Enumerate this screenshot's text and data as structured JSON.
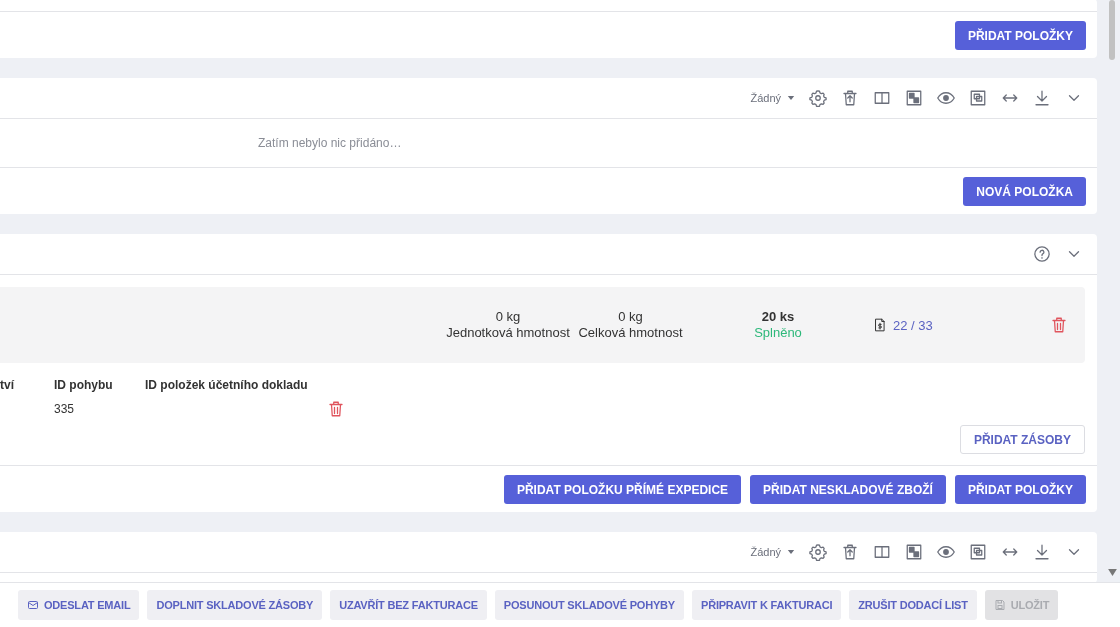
{
  "top_panel": {
    "buttons": [
      {
        "label": "PŘIDAT POLOŽKY",
        "kind": "primary"
      }
    ]
  },
  "list_panel": {
    "toolbar": {
      "filter": "Žádný"
    },
    "empty_text": "Zatím nebylo nic přidáno…",
    "buttons": [
      {
        "label": "NOVÁ POLOŽKA",
        "kind": "primary"
      }
    ]
  },
  "item_panel": {
    "item": {
      "unit_weight": "0 kg",
      "unit_weight_label": "Jednotková hmotnost",
      "total_weight": "0 kg",
      "total_weight_label": "Celková hmotnost",
      "quantity": "20 ks",
      "status": "Splněno",
      "documents": "22 / 33"
    },
    "movements": {
      "columns": [
        "tví",
        "ID pohybu",
        "ID položek účetního dokladu"
      ],
      "rows": [
        {
          "movement_id": "335"
        }
      ]
    },
    "add_stock": {
      "label": "PŘIDAT ZÁSOBY",
      "kind": "outline"
    },
    "buttons": [
      {
        "label": "PŘIDAT POLOŽKU PŘÍMÉ EXPEDICE",
        "kind": "primary"
      },
      {
        "label": "PŘIDAT NESKLADOVÉ ZBOŽÍ",
        "kind": "primary"
      },
      {
        "label": "PŘIDAT POLOŽKY",
        "kind": "primary"
      }
    ]
  },
  "bottom_panel": {
    "toolbar": {
      "filter": "Žádný"
    }
  },
  "action_bar": [
    {
      "label": "ODESLAT EMAIL",
      "disabled": false
    },
    {
      "label": "DOPLNIT SKLADOVÉ ZÁSOBY",
      "disabled": false
    },
    {
      "label": "UZAVŘÍT BEZ FAKTURACE",
      "disabled": false
    },
    {
      "label": "POSUNOUT SKLADOVÉ POHYBY",
      "disabled": false
    },
    {
      "label": "PŘIPRAVIT K FAKTURACI",
      "disabled": false
    },
    {
      "label": "ZRUŠIT DODACÍ LIST",
      "disabled": false
    },
    {
      "label": "ULOŽIT",
      "disabled": true
    }
  ]
}
